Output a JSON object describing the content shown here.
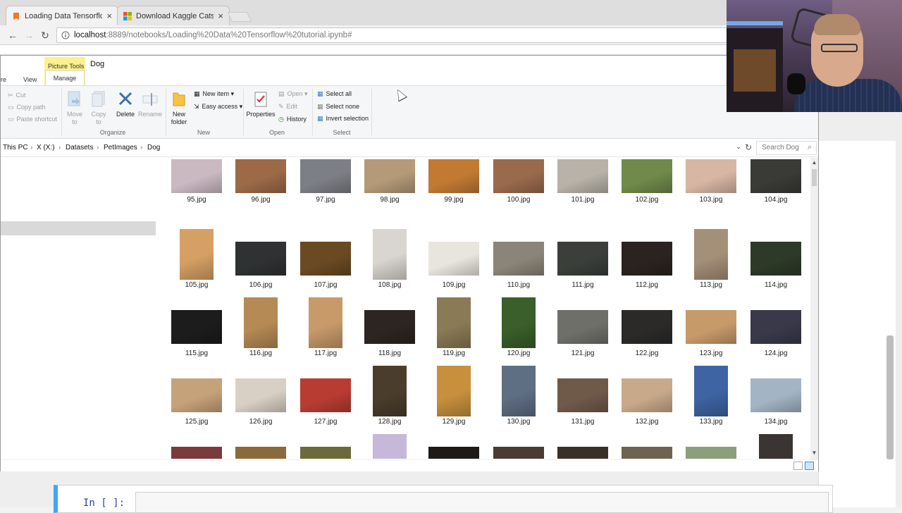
{
  "browser": {
    "tabs": [
      {
        "label": "Loading Data Tensorflow",
        "favicon": "jupyter-icon",
        "active": true
      },
      {
        "label": "Download Kaggle Cats and",
        "favicon": "windows-icon",
        "active": false
      }
    ],
    "url_host": "localhost",
    "url_path": ":8889/notebooks/Loading%20Data%20Tensorflow%20tutorial.ipynb#"
  },
  "explorer": {
    "title": "Dog",
    "contextual_tab_label": "Picture Tools",
    "ribbon_tabs": {
      "share": "re",
      "view": "View",
      "manage": "Manage"
    },
    "clipboard": {
      "cut": "Cut",
      "copy_path": "Copy path",
      "paste_shortcut": "Paste shortcut"
    },
    "organize": {
      "move_to": "Move\nto",
      "copy_to": "Copy\nto",
      "delete": "Delete",
      "rename": "Rename",
      "group": "Organize"
    },
    "new": {
      "new_folder": "New\nfolder",
      "new_item": "New item",
      "easy_access": "Easy access",
      "group": "New"
    },
    "open": {
      "properties": "Properties",
      "open": "Open",
      "edit": "Edit",
      "history": "History",
      "group": "Open"
    },
    "select": {
      "select_all": "Select all",
      "select_none": "Select none",
      "invert_selection": "Invert selection",
      "group": "Select"
    },
    "breadcrumb": [
      "This PC",
      "X (X:)",
      "Datasets",
      "PetImages",
      "Dog"
    ],
    "search_placeholder": "Search Dog",
    "files": [
      "95.jpg",
      "96.jpg",
      "97.jpg",
      "98.jpg",
      "99.jpg",
      "100.jpg",
      "101.jpg",
      "102.jpg",
      "103.jpg",
      "104.jpg",
      "105.jpg",
      "106.jpg",
      "107.jpg",
      "108.jpg",
      "109.jpg",
      "110.jpg",
      "111.jpg",
      "112.jpg",
      "113.jpg",
      "114.jpg",
      "115.jpg",
      "116.jpg",
      "117.jpg",
      "118.jpg",
      "119.jpg",
      "120.jpg",
      "121.jpg",
      "122.jpg",
      "123.jpg",
      "124.jpg",
      "125.jpg",
      "126.jpg",
      "127.jpg",
      "128.jpg",
      "129.jpg",
      "130.jpg",
      "131.jpg",
      "132.jpg",
      "133.jpg",
      "134.jpg",
      "",
      "",
      "",
      "",
      "",
      "",
      "",
      "",
      "",
      ""
    ],
    "thumb_colors": [
      "#cbb9c2",
      "#9c6a47",
      "#7d7f86",
      "#b49a78",
      "#c27a33",
      "#9a6a4c",
      "#b8b2a8",
      "#6f8a4a",
      "#d8b6a4",
      "#3a3a36",
      "#d6a064",
      "#2f3233",
      "#6a4a22",
      "#d9d5d0",
      "#e8e5de",
      "#8b8478",
      "#3a3f3a",
      "#2b2320",
      "#a48f78",
      "#2d3a28",
      "#1c1c1c",
      "#b58a55",
      "#c89a6a",
      "#2c2521",
      "#8a7a55",
      "#3a5f2a",
      "#6f6f6a",
      "#2b2a29",
      "#c79a6a",
      "#39394a",
      "#c6a27a",
      "#d8d0c4",
      "#b83c32",
      "#4a3d2b",
      "#c8903d",
      "#5e6e83",
      "#6f5a4a",
      "#c8a98a",
      "#3e64a3",
      "#a3b4c4",
      "#7a3a3e",
      "#8a6a3a",
      "#6a6a3a",
      "#c6b8d9",
      "#1e1a17",
      "#4a3b33",
      "#3a3028",
      "#6e6350",
      "#8b9f7a",
      "#3a3533"
    ]
  },
  "notebook": {
    "prompt": "In [ ]:"
  }
}
